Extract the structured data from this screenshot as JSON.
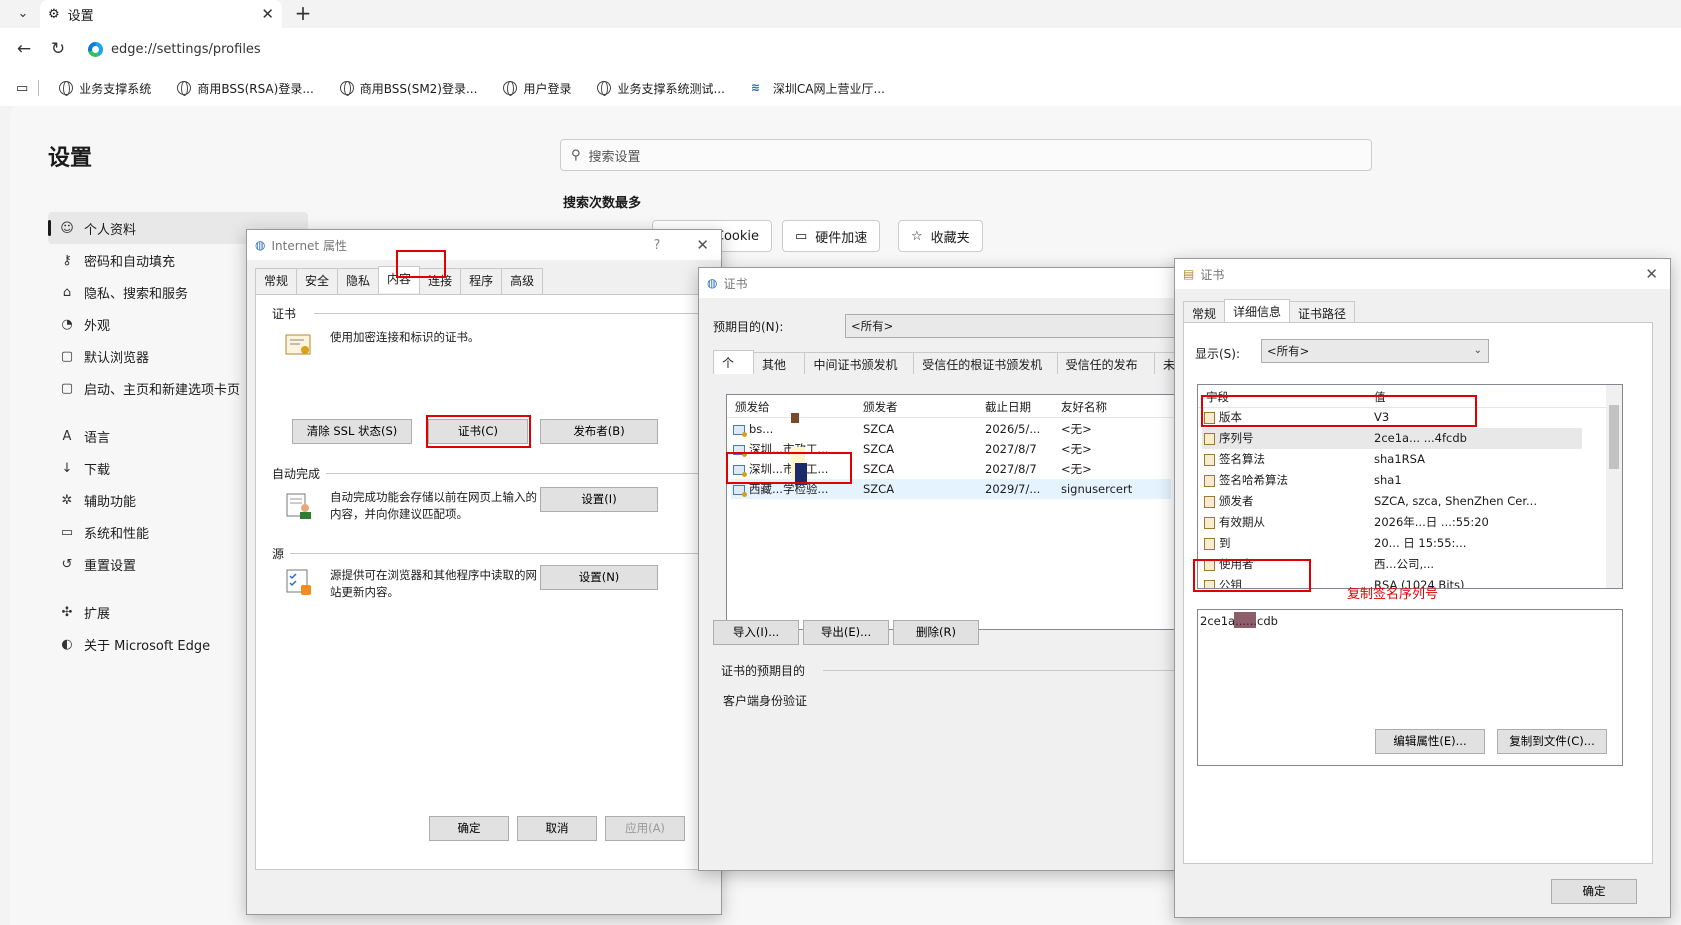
{
  "browser": {
    "tab_title": "设置",
    "address": "edge://settings/profiles",
    "favorites": [
      "业务支撑系统",
      "商用BSS(RSA)登录...",
      "商用BSS(SM2)登录...",
      "用户登录",
      "业务支撑系统测试...",
      "深圳CA网上营业厅..."
    ]
  },
  "settings": {
    "title": "设置",
    "search_placeholder": "搜索设置",
    "most_searched": "搜索次数最多",
    "chips": [
      "Cookie",
      "硬件加速",
      "收藏夹"
    ],
    "nav": [
      "个人资料",
      "密码和自动填充",
      "隐私、搜索和服务",
      "外观",
      "默认浏览器",
      "启动、主页和新建选项卡页",
      "语言",
      "下载",
      "辅助功能",
      "系统和性能",
      "重置设置",
      "扩展",
      "关于 Microsoft Edge"
    ]
  },
  "internet_props": {
    "title": "Internet 属性",
    "help": "?",
    "tabs": [
      "常规",
      "安全",
      "隐私",
      "内容",
      "连接",
      "程序",
      "高级"
    ],
    "cert_group": "证书",
    "cert_desc": "使用加密连接和标识的证书。",
    "clear_ssl": "清除 SSL 状态(S)",
    "certs_button": "证书(C)",
    "publishers": "发布者(B)",
    "autocomplete_group": "自动完成",
    "autocomplete_desc": "自动完成功能会存储以前在网页上输入的内容，并向你建议匹配项。",
    "settings_i": "设置(I)",
    "feeds_group": "源",
    "feeds_desc": "源提供可在浏览器和其他程序中读取的网站更新内容。",
    "settings_n": "设置(N)",
    "ok": "确定",
    "cancel": "取消",
    "apply": "应用(A)"
  },
  "cert_dialog": {
    "title": "证书",
    "purpose_label": "预期目的(N):",
    "purpose_value": "<所有>",
    "tabs": [
      "个人",
      "其他人",
      "中间证书颁发机构",
      "受信任的根证书颁发机构",
      "受信任的发布者",
      "未"
    ],
    "headers": [
      "颁发给",
      "颁发者",
      "截止日期",
      "友好名称"
    ],
    "rows": [
      [
        "bs...",
        "SZCA",
        "2026/5/...",
        "<无>"
      ],
      [
        "深圳...市政工...",
        "SZCA",
        "2027/8/7",
        "<无>"
      ],
      [
        "深圳...市政工...",
        "SZCA",
        "2027/8/7",
        "<无>"
      ],
      [
        "西藏...学检验...",
        "SZCA",
        "2029/7/...",
        "signusercert"
      ]
    ],
    "import": "导入(I)...",
    "export": "导出(E)...",
    "remove": "删除(R)",
    "purpose_section": "证书的预期目的",
    "purpose_text": "客户端身份验证"
  },
  "cert_detail": {
    "title": "证书",
    "tabs": [
      "常规",
      "详细信息",
      "证书路径"
    ],
    "show_label": "显示(S):",
    "show_value": "<所有>",
    "headers": [
      "字段",
      "值"
    ],
    "fields": [
      [
        "版本",
        "V3"
      ],
      [
        "序列号",
        "2ce1a... ...4fcdb"
      ],
      [
        "签名算法",
        "sha1RSA"
      ],
      [
        "签名哈希算法",
        "sha1"
      ],
      [
        "颁发者",
        "SZCA, szca, ShenZhen Cer..."
      ],
      [
        "有效期从",
        "2026年...日 ...:55:20"
      ],
      [
        "到",
        "20... 日 15:55:..."
      ],
      [
        "使用者",
        "西...公司,..."
      ],
      [
        "公钥",
        "RSA (1024 Bits)"
      ]
    ],
    "value_text": "2ce1a......cdb",
    "annotation": "复制签名序列号",
    "edit_props": "编辑属性(E)...",
    "copy_to_file": "复制到文件(C)...",
    "ok": "确定"
  }
}
